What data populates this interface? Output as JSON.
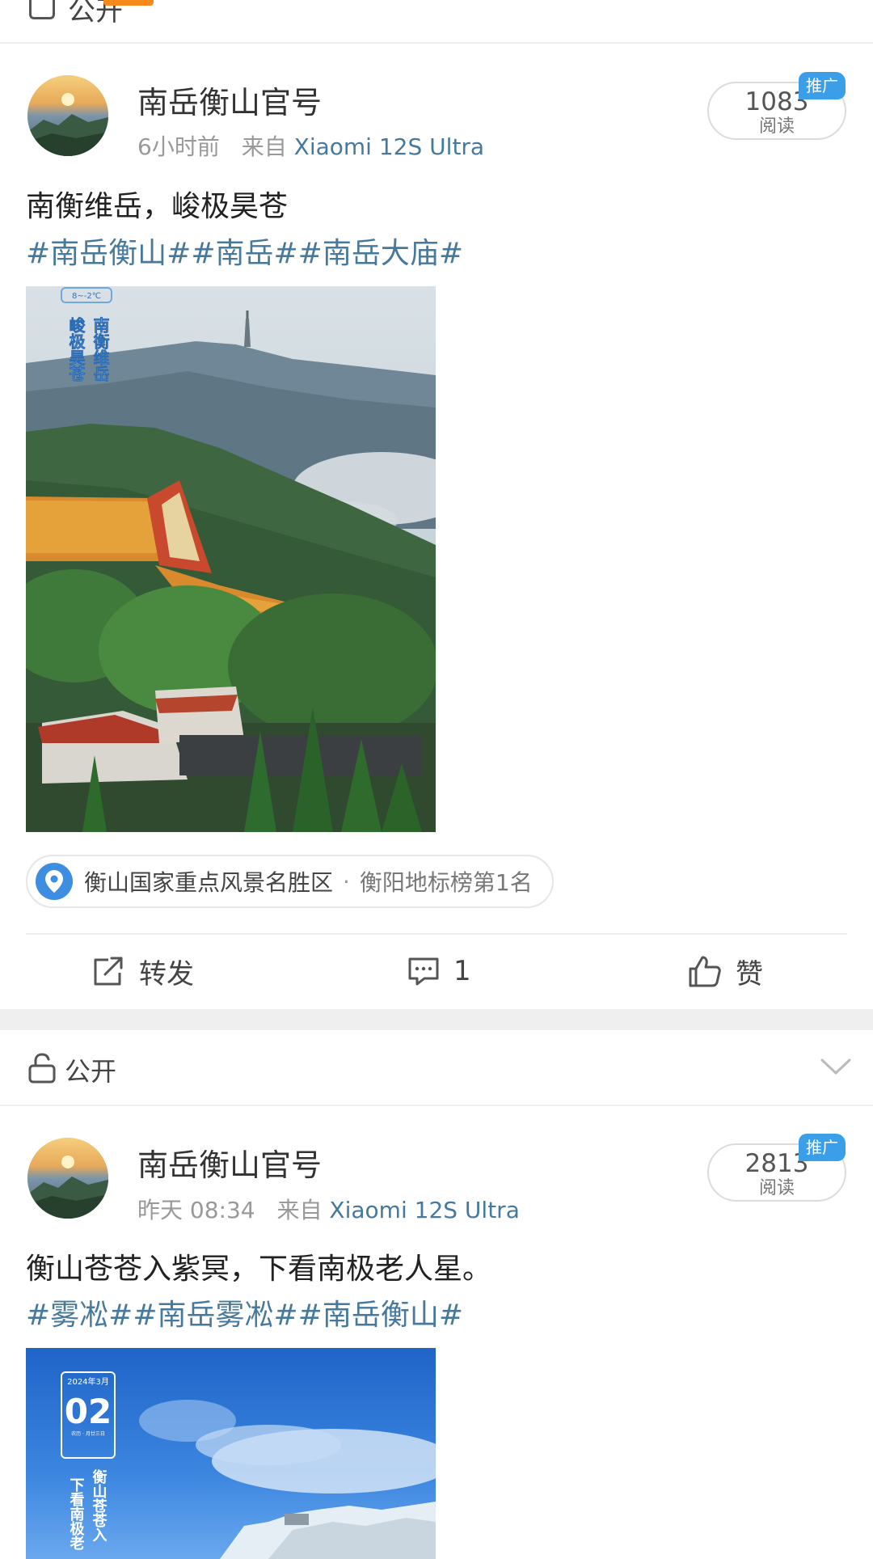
{
  "colors": {
    "accent_link": "#46799c",
    "ad_tag_bg": "#3b9ee8",
    "location_icon_bg": "#3d8de0",
    "top_indicator": "#f78a1d"
  },
  "top_partial": {
    "label": "公开"
  },
  "posts": [
    {
      "author": "南岳衡山官号",
      "time": "6小时前",
      "from_prefix": "来自",
      "source": "Xiaomi 12S Ultra",
      "reads": "1083",
      "reads_label": "阅读",
      "ad_tag": "推广",
      "text": "南衡维岳，峻极昊苍",
      "hashtags": "#南岳衡山##南岳##南岳大庙#",
      "image_overlay": {
        "weather": "8~-2℃",
        "poem_col1": "南衡维岳",
        "poem_col2": "峻极昊苍"
      },
      "location": {
        "name": "衡山国家重点风景名胜区",
        "separator": "·",
        "rank": "衡阳地标榜第1名"
      },
      "actions": {
        "repost": "转发",
        "comments": "1",
        "like": "赞"
      }
    },
    {
      "visibility": "公开",
      "author": "南岳衡山官号",
      "time": "昨天 08:34",
      "from_prefix": "来自",
      "source": "Xiaomi 12S Ultra",
      "reads": "2813",
      "reads_label": "阅读",
      "ad_tag": "推广",
      "text": "衡山苍苍入紫冥，下看南极老人星。",
      "hashtags": "#雾凇##南岳雾凇##南岳衡山#",
      "image_overlay": {
        "date_header": "2024年3月",
        "date_day": "02",
        "date_lunar": "农历 · 月廿三日",
        "poem_col1": "衡山苍苍入",
        "poem_col2": "下看南极老"
      }
    }
  ]
}
